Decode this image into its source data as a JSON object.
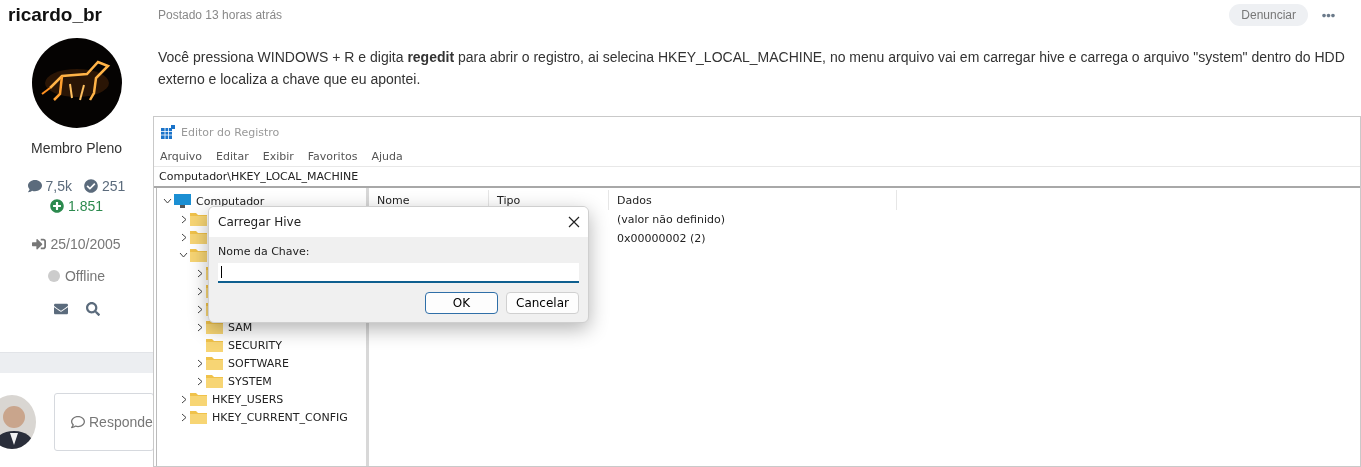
{
  "post": {
    "author": {
      "name": "ricardo_br",
      "rank": "Membro Pleno",
      "posts": "7,5k",
      "solutions": "251",
      "reputation": "1.851",
      "joined": "25/10/2005",
      "status": "Offline",
      "online": false
    },
    "meta": "Postado 13 horas atrás",
    "report_button": "Denunciar",
    "text": "Você pressiona WINDOWS + R e digita **regedit** para abrir o registro, ai selecina HKEY_LOCAL_MACHINE, no menu arquivo vai em carregar hive e carrega o arquivo \"system\" dentro do HDD externo e localiza a chave que eu apontei.",
    "screenshot": {
      "title": "Editor do Registro",
      "menu": [
        "Arquivo",
        "Editar",
        "Exibir",
        "Favoritos",
        "Ajuda"
      ],
      "address": "Computador\\HKEY_LOCAL_MACHINE",
      "tree": {
        "label": "Computador",
        "kind": "computer",
        "expandable": true,
        "expanded": true,
        "children": [
          {
            "kind": "folder",
            "expandable": true,
            "expanded": false
          },
          {
            "kind": "folder",
            "expandable": true,
            "expanded": false
          },
          {
            "kind": "folder",
            "expandable": true,
            "expanded": true,
            "children": [
              {
                "kind": "folder",
                "expandable": true,
                "expanded": false
              },
              {
                "kind": "folder",
                "expandable": true,
                "expanded": false
              },
              {
                "kind": "folder",
                "expandable": true,
                "expanded": false
              },
              {
                "label": "SAM",
                "kind": "folder",
                "expandable": true,
                "expanded": false
              },
              {
                "label": "SECURITY",
                "kind": "folder",
                "expandable": false
              },
              {
                "label": "SOFTWARE",
                "kind": "folder",
                "expandable": true,
                "expanded": false
              },
              {
                "label": "SYSTEM",
                "kind": "folder",
                "expandable": true,
                "expanded": false
              }
            ]
          },
          {
            "label": "HKEY_USERS",
            "kind": "folder",
            "expandable": true,
            "expanded": false
          },
          {
            "label": "HKEY_CURRENT_CONFIG",
            "kind": "folder",
            "expandable": true,
            "expanded": false
          }
        ]
      },
      "columns": [
        "Nome",
        "Tipo",
        "Dados"
      ],
      "rows": [
        {
          "data": "(valor não definido)"
        },
        {
          "data": "0x00000002 (2)"
        }
      ],
      "dialog": {
        "title": "Carregar Hive",
        "field_label": "Nome da Chave:",
        "focused": true,
        "buttons": [
          {
            "label": "OK",
            "default": true
          },
          {
            "label": "Cancelar",
            "default": false
          }
        ]
      }
    }
  },
  "next_post": {
    "reply_prompt": "Responde"
  }
}
